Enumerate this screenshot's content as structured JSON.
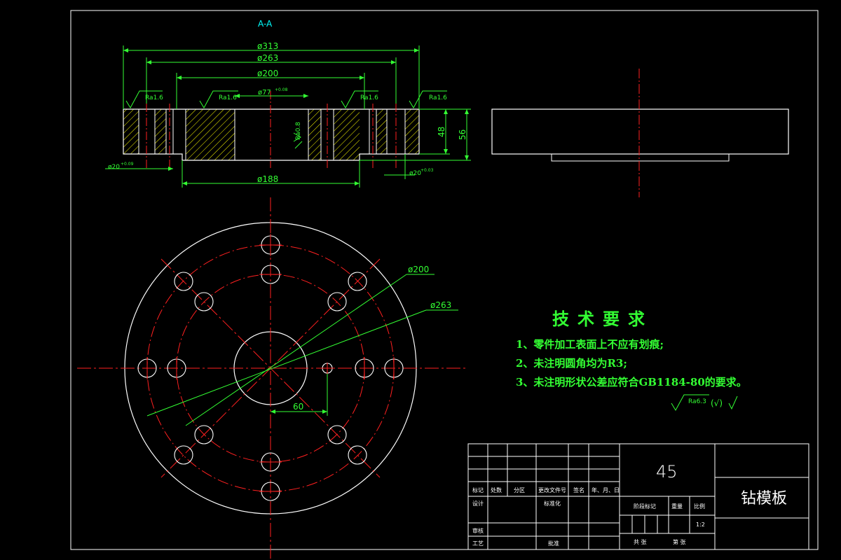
{
  "section_label": "A-A",
  "dimensions": {
    "d313": "ø313",
    "d263": "ø263",
    "d200": "ø200",
    "d77": "ø77",
    "d77_tol": "+0.08",
    "h48": "48",
    "h56": "56",
    "d20_left": "ø20",
    "d20_left_tol": "+0.09",
    "d20_right": "ø20",
    "d20_right_tol": "+0.03",
    "d188": "ø188",
    "ra08": "Ra0.8",
    "plan_d200": "ø200",
    "plan_d263": "ø263",
    "plan_60": "60"
  },
  "roughness": [
    "Ra1.6",
    "Ra1.6",
    "Ra1.6",
    "Ra1.6"
  ],
  "general_roughness": {
    "value": "Ra6.3",
    "suffix": "(√)"
  },
  "requirements": {
    "title": "技术要求",
    "items": [
      "1、零件加工表面上不应有划痕;",
      "2、未注明圆角均为R3;",
      "3、未注明形状公差应符合GB1184-80的要求。"
    ]
  },
  "title_block": {
    "material": "45",
    "part_name": "钻模板",
    "headers": [
      "标记",
      "处数",
      "分区",
      "更改文件号",
      "签名",
      "年、月、日"
    ],
    "row_design": "设计",
    "row_standard": "标准化",
    "row_review": "审核",
    "row_process": "工艺",
    "row_approve": "批准",
    "stage_label": "阶段标记",
    "weight_label": "重量",
    "scale_label": "比例",
    "scale_value": "1:2",
    "sheets_total": "共  张",
    "sheet_num": "第  张"
  },
  "colors": {
    "outline": "#ffffff",
    "dimension": "#33ff33",
    "centerline": "#ff2020",
    "hatch": "#ffff00",
    "label": "#00ffff"
  }
}
